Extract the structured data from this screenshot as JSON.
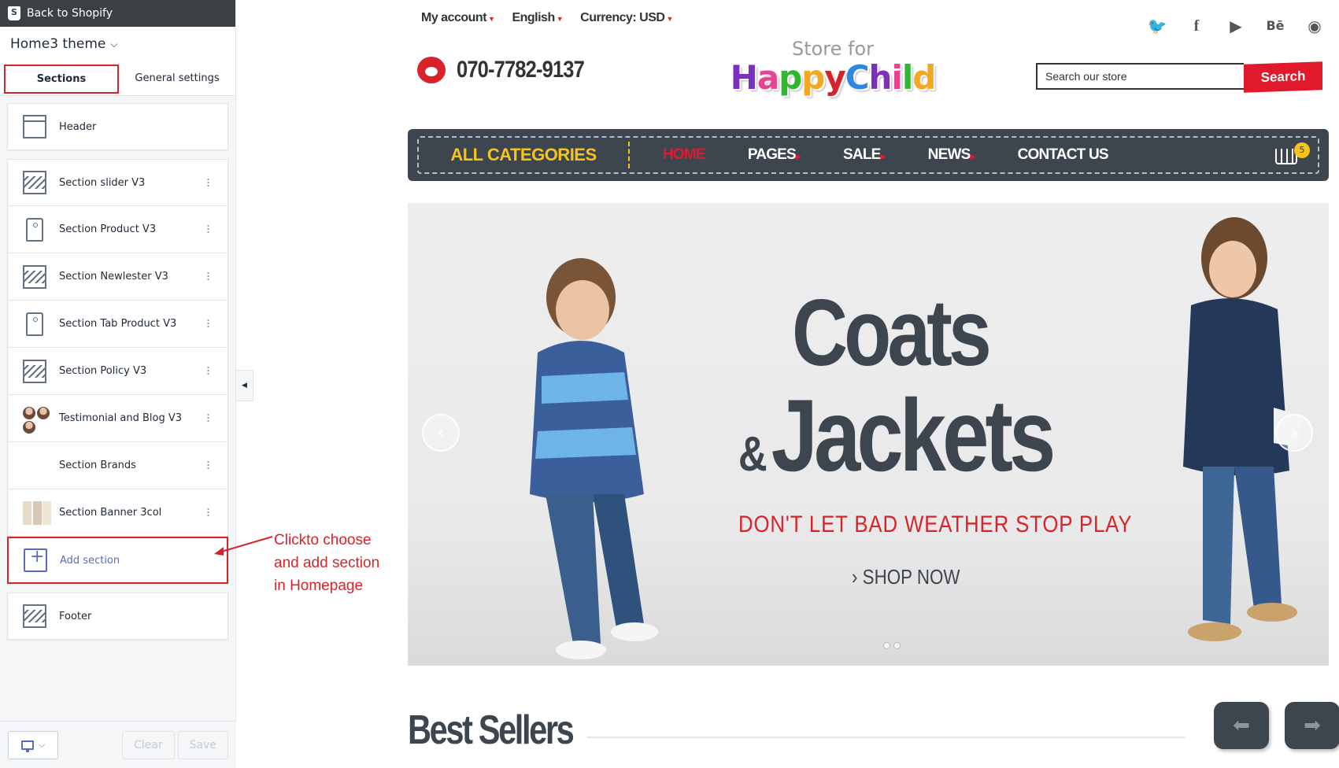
{
  "editor": {
    "back_label": "Back to Shopify",
    "theme_name": "Home3 theme",
    "tabs": [
      {
        "label": "Sections"
      },
      {
        "label": "General settings"
      }
    ],
    "header_section": "Header",
    "sections": [
      {
        "label": "Section slider V3",
        "icon": "image-placeholder-icon"
      },
      {
        "label": "Section Product V3",
        "icon": "product-tag-icon"
      },
      {
        "label": "Section Newlester V3",
        "icon": "image-placeholder-icon"
      },
      {
        "label": "Section Tab Product V3",
        "icon": "product-tag-icon"
      },
      {
        "label": "Section Policy V3",
        "icon": "image-placeholder-icon"
      },
      {
        "label": "Testimonial and Blog V3",
        "icon": "avatar-thumbnails-icon"
      },
      {
        "label": "Section Brands",
        "icon": "brands-thumbnail-icon"
      },
      {
        "label": "Section Banner 3col",
        "icon": "banner-thumbnail-icon"
      }
    ],
    "add_section_label": "Add section",
    "footer_section": "Footer",
    "clear_label": "Clear",
    "save_label": "Save",
    "accent_color": "#5c6ac4"
  },
  "callout": {
    "lines": [
      "Clickto choose",
      "and add section",
      "in Homepage"
    ],
    "color": "#d8232a"
  },
  "store": {
    "topnav": [
      {
        "label": "My account"
      },
      {
        "label": "English"
      },
      {
        "label": "Currency: USD"
      }
    ],
    "social_icons": [
      "twitter-icon",
      "facebook-icon",
      "youtube-icon",
      "behance-icon",
      "dribbble-icon"
    ],
    "phone": "070-7782-9137",
    "logo_small": "Store for",
    "logo_big": [
      "H",
      "a",
      "p",
      "p",
      "y",
      "C",
      "h",
      "i",
      "l",
      "d"
    ],
    "search_placeholder": "Search our store",
    "search_button": "Search",
    "all_categories": "ALL CATEGORIES",
    "menu": [
      {
        "label": "HOME",
        "dropdown": false
      },
      {
        "label": "PAGES",
        "dropdown": true
      },
      {
        "label": "SALE",
        "dropdown": true
      },
      {
        "label": "NEWS",
        "dropdown": true
      },
      {
        "label": "CONTACT US",
        "dropdown": false
      }
    ],
    "cart_count": "5",
    "hero": {
      "line1": "Coats",
      "amp": "&",
      "line2": "Jackets",
      "subtitle": "DON'T LET BAD WEATHER STOP PLAY",
      "cta": "› SHOP NOW"
    },
    "best_sellers_title": "Best Sellers",
    "brand_red": "#e0192d",
    "menu_bg": "#3d454f",
    "yellow": "#f7c519"
  }
}
